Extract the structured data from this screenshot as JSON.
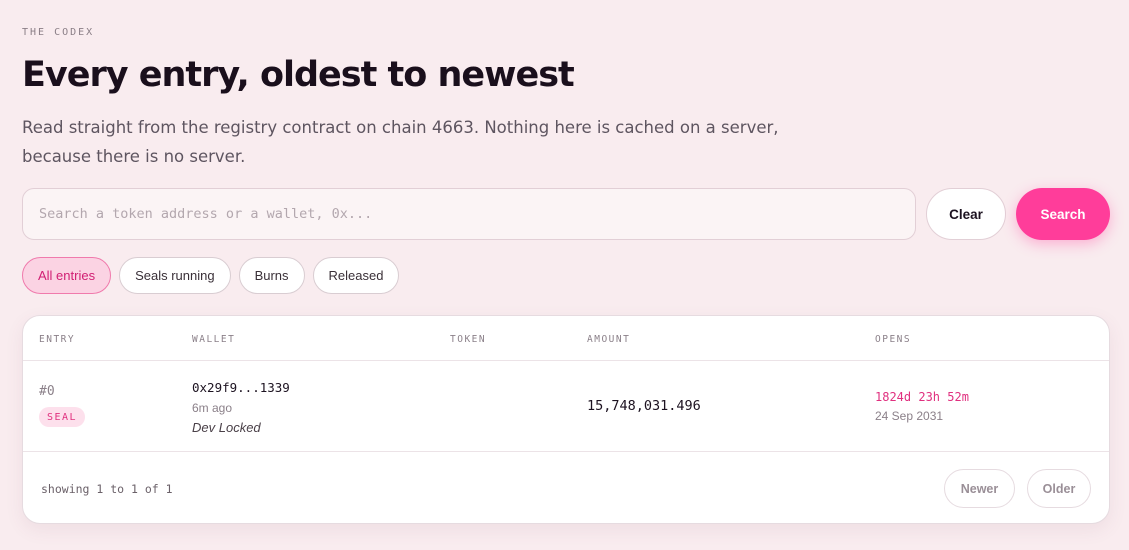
{
  "header": {
    "eyebrow": "THE CODEX",
    "title": "Every entry, oldest to newest",
    "subtitle": "Read straight from the registry contract on chain 4663. Nothing here is cached on a server, because there is no server."
  },
  "search": {
    "placeholder": "Search a token address or a wallet, 0x...",
    "value": "",
    "clear_label": "Clear",
    "search_label": "Search"
  },
  "filters": [
    {
      "label": "All entries",
      "active": true
    },
    {
      "label": "Seals running",
      "active": false
    },
    {
      "label": "Burns",
      "active": false
    },
    {
      "label": "Released",
      "active": false
    }
  ],
  "table": {
    "columns": [
      "ENTRY",
      "WALLET",
      "TOKEN",
      "AMOUNT",
      "OPENS"
    ],
    "rows": [
      {
        "entry": "#0",
        "type": "SEAL",
        "wallet": "0x29f9...1339",
        "time": "6m ago",
        "note": "Dev Locked",
        "token": "",
        "amount": "15,748,031.496",
        "opens_countdown": "1824d 23h 52m",
        "opens_date": "24 Sep 2031"
      }
    ]
  },
  "pagination": {
    "summary": "showing 1 to 1 of 1",
    "newer_label": "Newer",
    "older_label": "Older"
  },
  "colors": {
    "background": "#f9ecef",
    "accent": "#ff3d9a",
    "accent_text": "#e0307f"
  }
}
